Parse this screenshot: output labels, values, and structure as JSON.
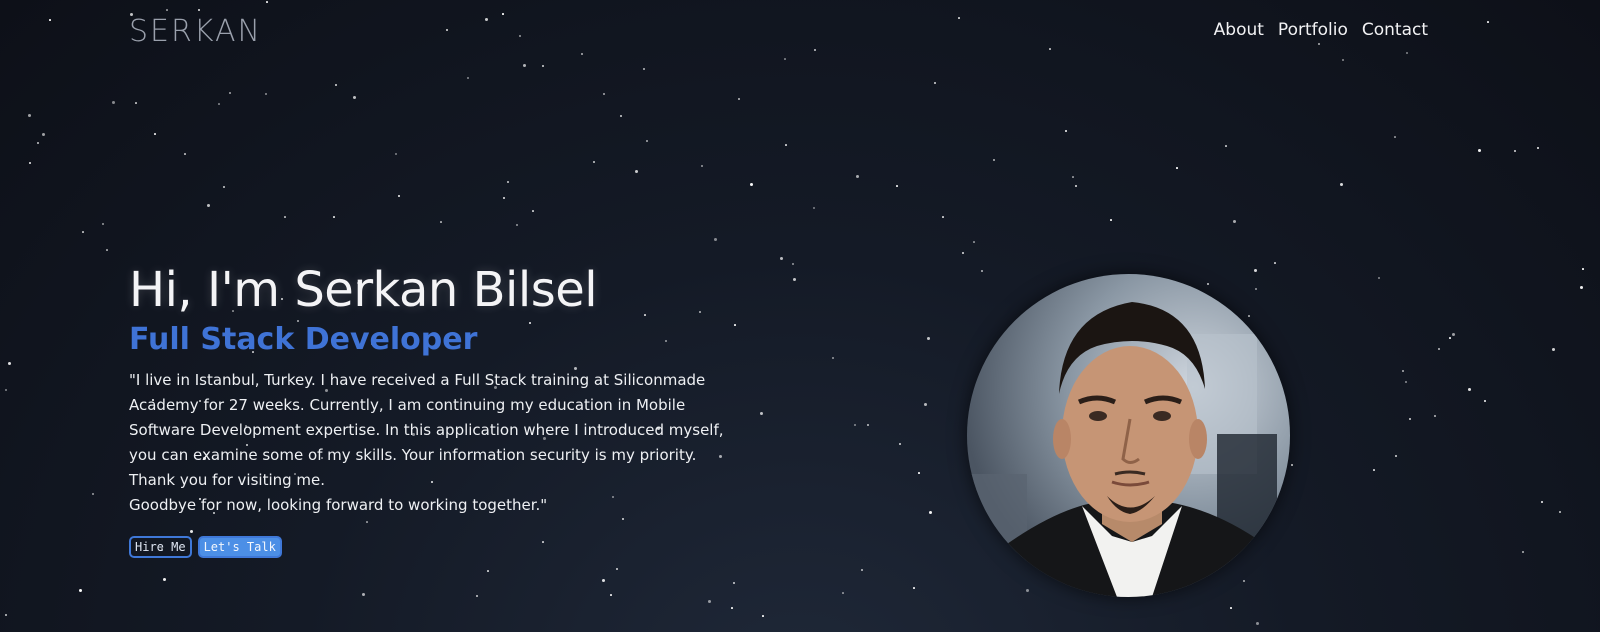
{
  "header": {
    "logo": "SERKAN",
    "nav": [
      {
        "label": "About"
      },
      {
        "label": "Portfolio"
      },
      {
        "label": "Contact"
      }
    ]
  },
  "hero": {
    "greeting": "Hi, I'm Serkan Bilsel",
    "role": "Full Stack Developer",
    "bio_line1": "\"I live in Istanbul, Turkey. I have received a Full Stack training at Siliconmade Academy for 27 weeks. Currently, I am continuing my education in Mobile Software Development expertise. In this application where I introduced myself, you can examine some of my skills. Your information security is my priority. Thank you for visiting me.",
    "bio_line2": "Goodbye for now, looking forward to working together.\"",
    "buttons": {
      "hire": "Hire Me",
      "talk": "Let's Talk"
    }
  },
  "colors": {
    "accent": "#3f73d6",
    "button_fill": "#4c8fe6",
    "background": "#141a26"
  }
}
